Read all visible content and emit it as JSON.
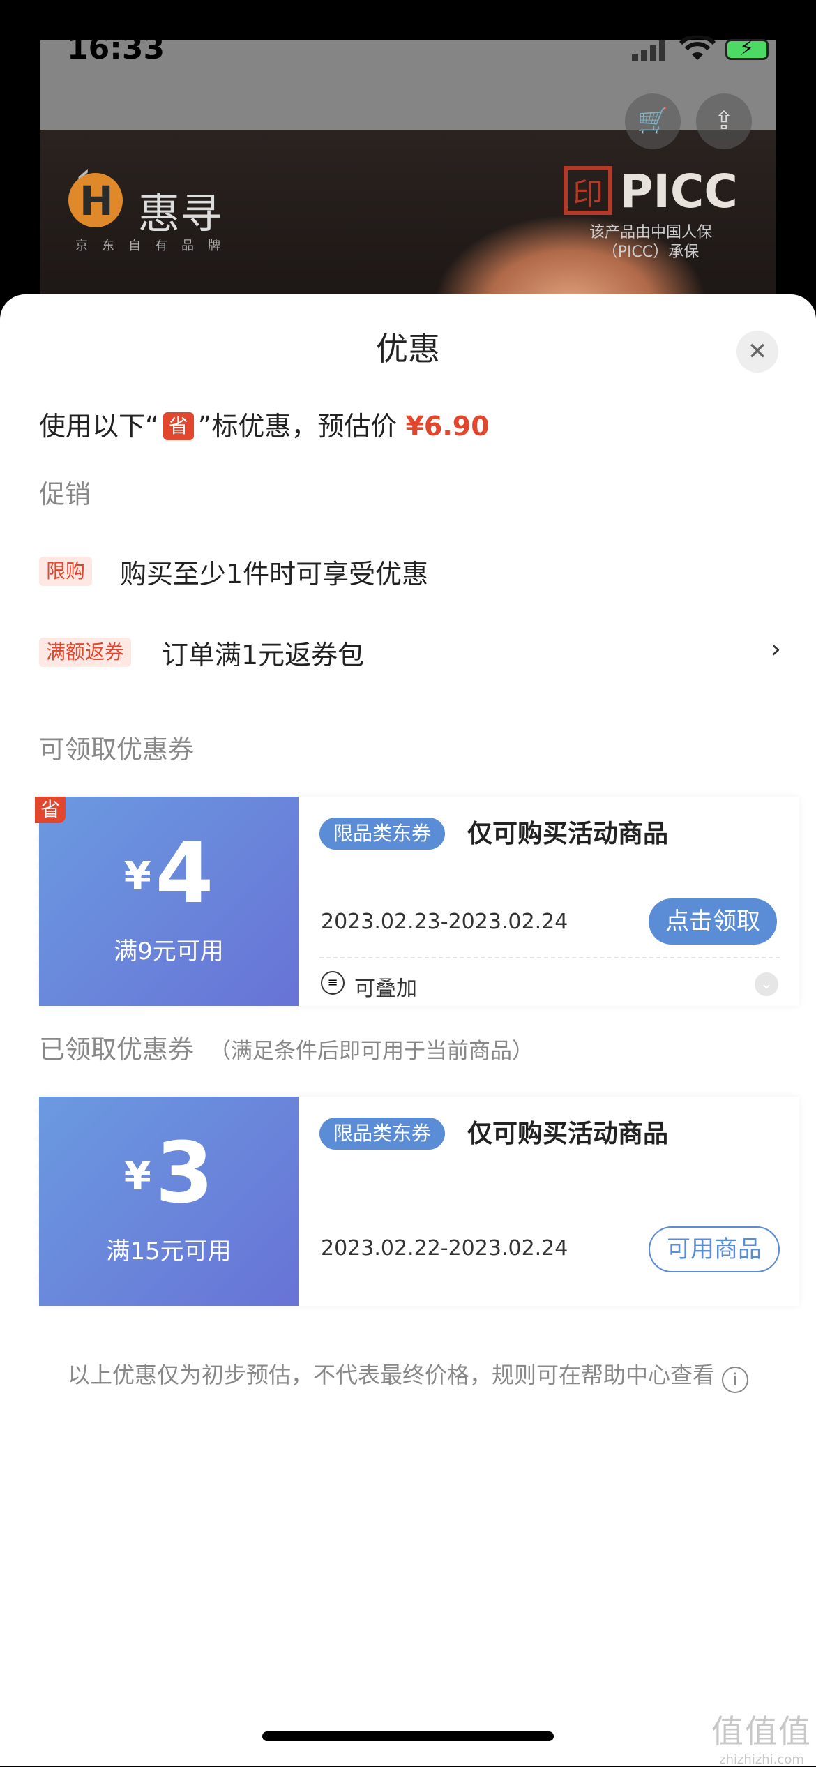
{
  "status_bar": {
    "time": "16:33"
  },
  "background": {
    "logo_text": "惠寻",
    "logo_sub": "京东自有品牌",
    "brand": "PICC",
    "brand_note_1": "该产品由中国人保",
    "brand_note_2": "（PICC）承保"
  },
  "sheet": {
    "title": "优惠",
    "estimate_prefix": "使用以下“",
    "save_tag": "省",
    "estimate_suffix": "”标优惠，预估价",
    "estimate_price": "¥6.90"
  },
  "promotions": {
    "label": "促销",
    "items": [
      {
        "tag": "限购",
        "text": "购买至少1件时可享受优惠"
      },
      {
        "tag": "满额返券",
        "text": "订单满1元返券包"
      }
    ]
  },
  "available_coupons": {
    "label": "可领取优惠券",
    "items": [
      {
        "corner_tag": "省",
        "yen": "¥",
        "amount": "4",
        "condition": "满9元可用",
        "chip": "限品类东券",
        "description": "仅可购买活动商品",
        "date_range": "2023.02.23-2023.02.24",
        "button": "点击领取",
        "stackable": "可叠加"
      }
    ]
  },
  "received_coupons": {
    "label": "已领取优惠券",
    "note": "（满足条件后即可用于当前商品）",
    "items": [
      {
        "yen": "¥",
        "amount": "3",
        "condition": "满15元可用",
        "chip": "限品类东券",
        "description": "仅可购买活动商品",
        "date_range": "2023.02.22-2023.02.24",
        "button": "可用商品"
      }
    ]
  },
  "footer_note": "以上优惠仅为初步预估，不代表最终价格，规则可在帮助中心查看",
  "watermark": {
    "big": "值值值",
    "small": "zhizhizhi.com"
  },
  "colors": {
    "accent_red": "#e2472e",
    "coupon_blue": "#5b8cd6"
  }
}
